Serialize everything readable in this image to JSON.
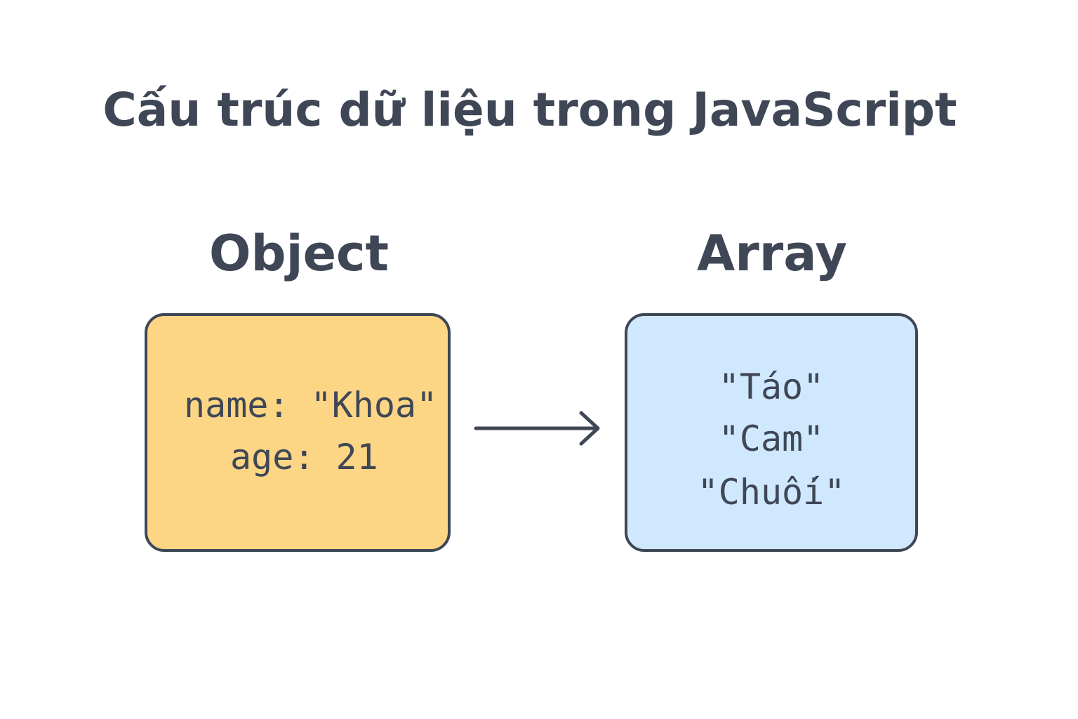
{
  "title": "Cấu trúc dữ liệu trong JavaScript",
  "object_panel": {
    "heading": "Object",
    "lines": [
      {
        "key": "name:",
        "value": "\"Khoa\""
      },
      {
        "key": "age:",
        "value": "21"
      }
    ],
    "fill_color": "#fcd685"
  },
  "array_panel": {
    "heading": "Array",
    "items": [
      "\"Táo\"",
      "\"Cam\"",
      "\"Chuối\""
    ],
    "fill_color": "#d0e8fd"
  },
  "colors": {
    "ink": "#3f4756",
    "background": "#ffffff"
  },
  "connector": {
    "icon": "arrow-right-icon"
  }
}
